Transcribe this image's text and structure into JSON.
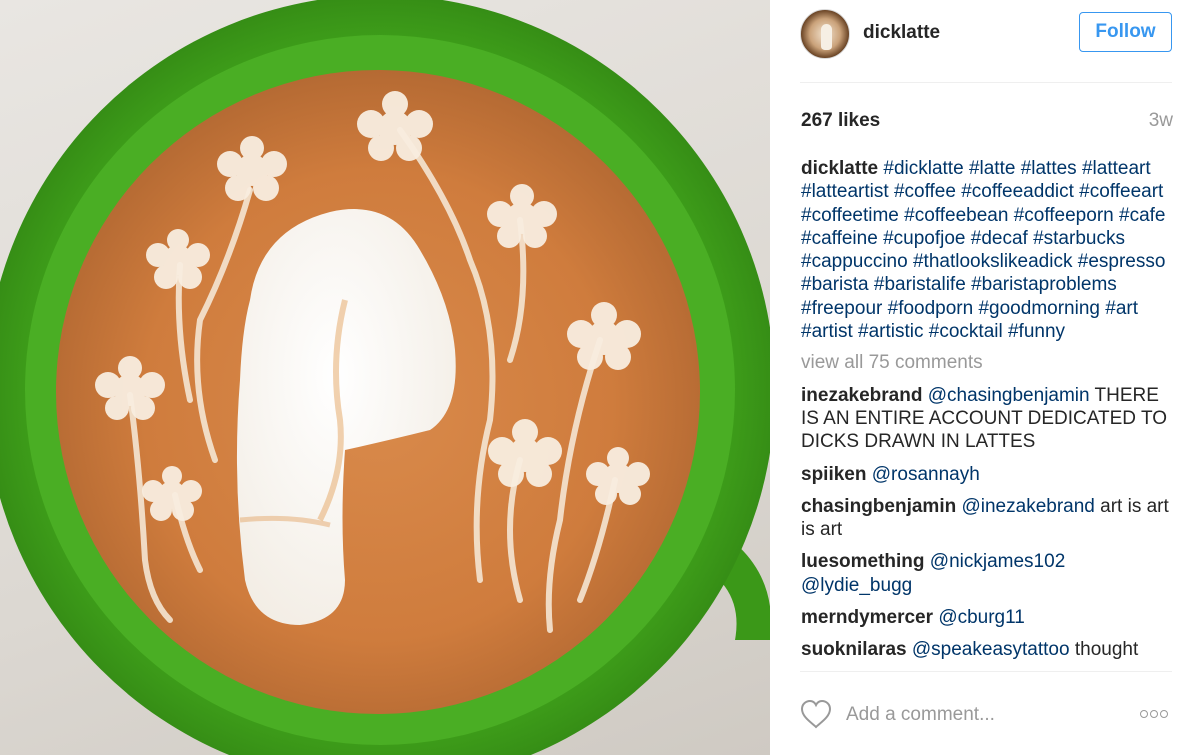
{
  "post": {
    "photo_icon": "latte-art-photo",
    "user": {
      "username": "dicklatte",
      "avatar_icon": "profile-avatar"
    },
    "follow_label": "Follow",
    "likes": "267 likes",
    "time": "3w",
    "caption": {
      "author": "dicklatte",
      "hashtags": [
        "#dicklatte",
        "#latte",
        "#lattes",
        "#latteart",
        "#latteartist",
        "#coffee",
        "#coffeeaddict",
        "#coffeeart",
        "#coffeetime",
        "#coffeebean",
        "#coffeeporn",
        "#cafe",
        "#caffeine",
        "#cupofjoe",
        "#decaf",
        "#starbucks",
        "#cappuccino",
        "#thatlookslikeadick",
        "#espresso",
        "#barista",
        "#baristalife",
        "#baristaproblems",
        "#freepour",
        "#foodporn",
        "#goodmorning",
        "#art",
        "#artist",
        "#artistic",
        "#cocktail",
        "#funny"
      ]
    },
    "view_all": "view all 75 comments",
    "comments": [
      {
        "author": "inezakebrand",
        "mentions": [
          "@chasingbenjamin"
        ],
        "text": "THERE IS AN ENTIRE ACCOUNT DEDICATED TO DICKS DRAWN IN LATTES"
      },
      {
        "author": "spiiken",
        "mentions": [
          "@rosannayh"
        ],
        "text": ""
      },
      {
        "author": "chasingbenjamin",
        "mentions": [
          "@inezakebrand"
        ],
        "text": "art is art is art"
      },
      {
        "author": "luesomething",
        "mentions": [
          "@nickjames102",
          "@lydie_bugg"
        ],
        "text": ""
      },
      {
        "author": "merndymercer",
        "mentions": [
          "@cburg11"
        ],
        "text": ""
      },
      {
        "author": "suoknilaras",
        "mentions": [
          "@speakeasytattoo"
        ],
        "text": "thought"
      }
    ],
    "add_comment_placeholder": "Add a comment...",
    "icons": {
      "like": "heart-icon",
      "more": "more-options-icon"
    },
    "colors": {
      "link": "#003569",
      "follow": "#3897f0",
      "muted": "#999999",
      "text": "#262626"
    }
  }
}
